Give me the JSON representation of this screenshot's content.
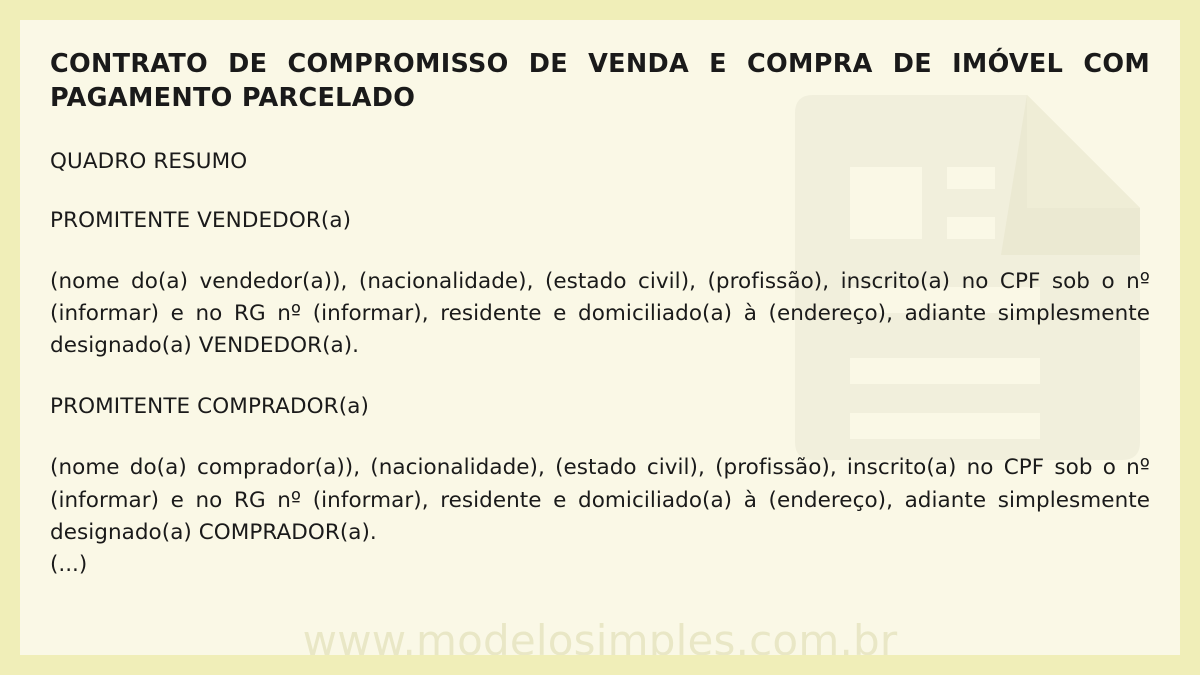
{
  "document": {
    "title": "CONTRATO DE COMPROMISSO DE VENDA E COMPRA DE IMÓVEL COM PAGAMENTO PARCELADO",
    "section_summary_heading": "QUADRO RESUMO",
    "seller_heading": "PROMITENTE VENDEDOR(a)",
    "seller_paragraph": "(nome do(a) vendedor(a)), (nacionalidade), (estado civil), (profissão), inscrito(a) no CPF sob o nº (informar) e no RG nº (informar), residente e domiciliado(a) à (endereço), adiante simplesmente designado(a) VENDEDOR(a).",
    "buyer_heading": "PROMITENTE COMPRADOR(a)",
    "buyer_paragraph": "(nome do(a) comprador(a)), (nacionalidade), (estado civil), (profissão), inscrito(a) no CPF sob o nº (informar) e no RG nº (informar), residente e domiciliado(a) à (endereço), adiante simplesmente designado(a) COMPRADOR(a).",
    "continuation_marker": "(...)"
  },
  "watermark": {
    "url_text": "www.modelosimples.com.br",
    "icon_name": "document-icon"
  },
  "colors": {
    "page_border": "#f0eeb8",
    "page_background": "#faf8e6",
    "text": "#1a1a1a",
    "watermark_url": "#e9e7c6",
    "watermark_icon": "#f1efdc",
    "watermark_icon_shadow": "#eae8d0"
  }
}
